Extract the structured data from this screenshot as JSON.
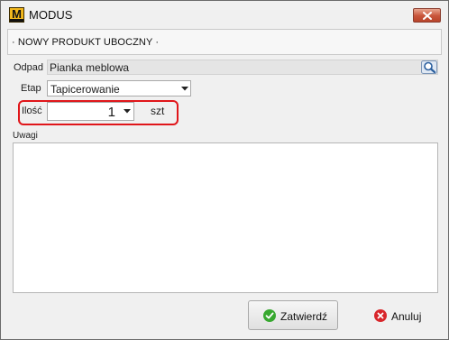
{
  "window": {
    "title": "MODUS",
    "logo_letter": "M"
  },
  "header": {
    "title": "· NOWY PRODUKT UBOCZNY ·"
  },
  "form": {
    "odpad_label": "Odpad",
    "odpad_value": "Pianka meblowa",
    "etap_label": "Etap",
    "etap_value": "Tapicerowanie",
    "ilosc_label": "Ilość",
    "ilosc_value": "1",
    "unit": "szt",
    "uwagi_label": "Uwagi",
    "uwagi_value": ""
  },
  "buttons": {
    "confirm_label": "Zatwierdź",
    "cancel_label": "Anuluj"
  },
  "icons": {
    "logo": "modus-logo-icon",
    "close": "close-icon",
    "search": "search-icon",
    "dropdown": "chevron-down-icon",
    "confirm": "check-icon",
    "cancel": "cancel-icon"
  },
  "colors": {
    "highlight": "#e0161a",
    "close_button": "#c8543a",
    "confirm_icon": "#37a82f",
    "cancel_icon": "#d8262b",
    "logo": "#f3b81c"
  }
}
